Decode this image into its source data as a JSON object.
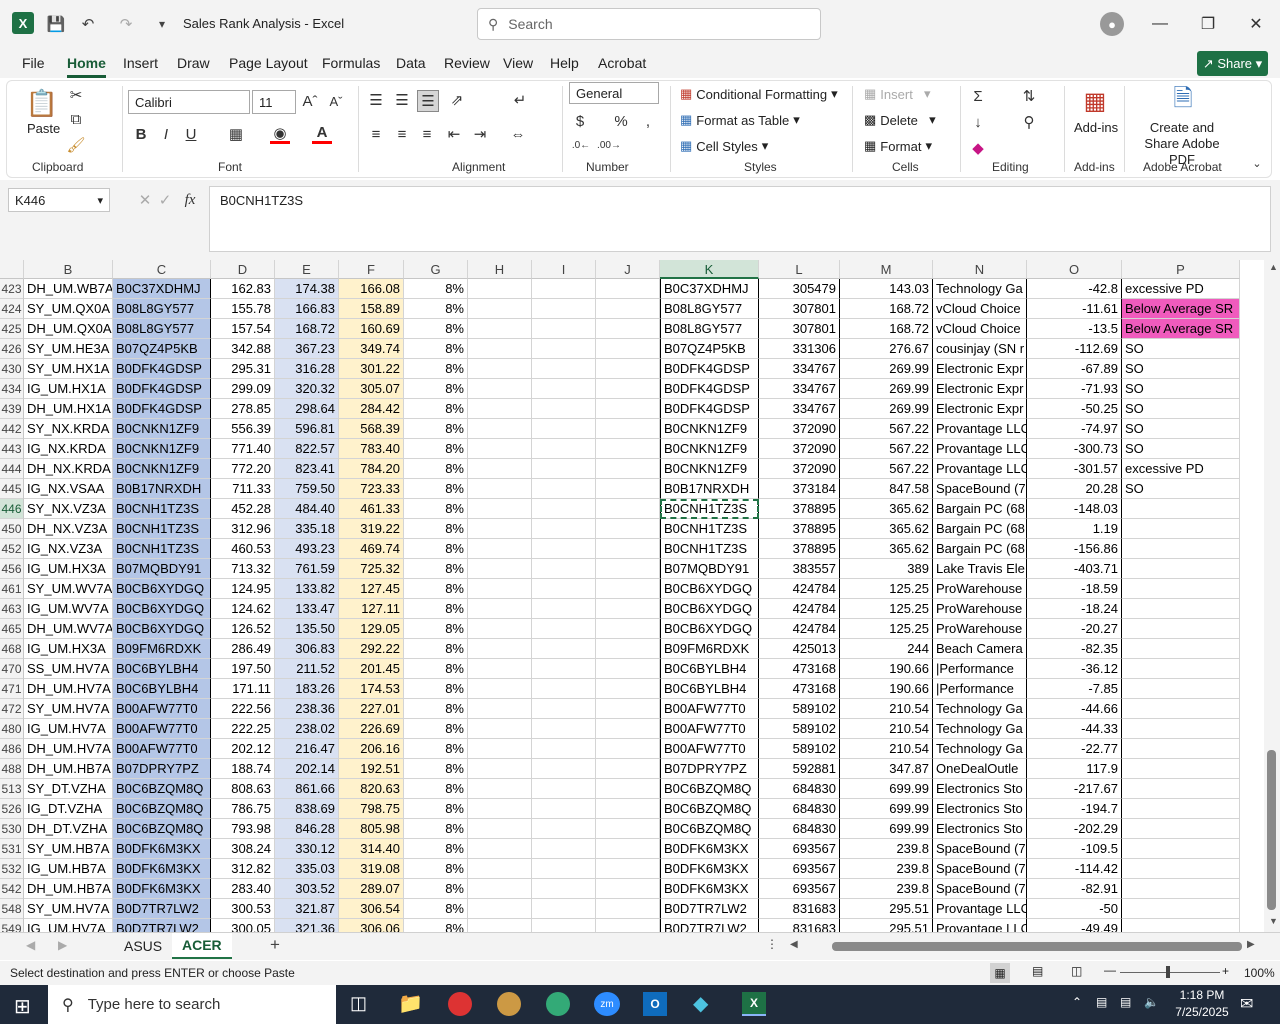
{
  "titlebar": {
    "doc_title": "Sales Rank Analysis  -  Excel",
    "search_placeholder": "Search"
  },
  "menu": [
    "File",
    "Home",
    "Insert",
    "Draw",
    "Page Layout",
    "Formulas",
    "Data",
    "Review",
    "View",
    "Help",
    "Acrobat"
  ],
  "share_label": "Share",
  "ribbon": {
    "paste": "Paste",
    "clipboard": "Clipboard",
    "font_name": "Calibri",
    "font_size": "11",
    "font": "Font",
    "alignment": "Alignment",
    "number_format": "General",
    "number": "Number",
    "cond_format": "Conditional Formatting",
    "format_table": "Format as Table",
    "cell_styles": "Cell Styles",
    "styles": "Styles",
    "insert": "Insert",
    "delete": "Delete",
    "format": "Format",
    "cells": "Cells",
    "editing": "Editing",
    "addins": "Add-ins",
    "addins_group": "Add-ins",
    "create_pdf": "Create and Share Adobe PDF",
    "acrobat_group": "Adobe Acrobat"
  },
  "formula": {
    "namebox": "K446",
    "value": "B0CNH1TZ3S"
  },
  "columns": [
    "B",
    "C",
    "D",
    "E",
    "F",
    "G",
    "H",
    "I",
    "J",
    "K",
    "L",
    "M",
    "N",
    "O",
    "P"
  ],
  "rows": [
    {
      "n": "423",
      "b": "DH_UM.WB7A",
      "c": "B0C37XDHMJ",
      "d": "162.83",
      "e": "174.38",
      "f": "166.08",
      "g": "8%",
      "k": "B0C37XDHMJ",
      "l": "305479",
      "m": "143.03",
      "nn": "Technology Ga",
      "o": "-42.8",
      "p": "excessive PD",
      "pink": false
    },
    {
      "n": "424",
      "b": "SY_UM.QX0A",
      "c": "B08L8GY577",
      "d": "155.78",
      "e": "166.83",
      "f": "158.89",
      "g": "8%",
      "k": "B08L8GY577",
      "l": "307801",
      "m": "168.72",
      "nn": "vCloud Choice",
      "o": "-11.61",
      "p": "Below Average SR",
      "pink": true
    },
    {
      "n": "425",
      "b": "DH_UM.QX0A",
      "c": "B08L8GY577",
      "d": "157.54",
      "e": "168.72",
      "f": "160.69",
      "g": "8%",
      "k": "B08L8GY577",
      "l": "307801",
      "m": "168.72",
      "nn": "vCloud Choice",
      "o": "-13.5",
      "p": "Below Average SR",
      "pink": true
    },
    {
      "n": "426",
      "b": "SY_UM.HE3A",
      "c": "B07QZ4P5KB",
      "d": "342.88",
      "e": "367.23",
      "f": "349.74",
      "g": "8%",
      "k": "B07QZ4P5KB",
      "l": "331306",
      "m": "276.67",
      "nn": "cousinjay (SN r",
      "o": "-112.69",
      "p": "SO",
      "pink": false
    },
    {
      "n": "430",
      "b": "SY_UM.HX1A",
      "c": "B0DFK4GDSP",
      "d": "295.31",
      "e": "316.28",
      "f": "301.22",
      "g": "8%",
      "k": "B0DFK4GDSP",
      "l": "334767",
      "m": "269.99",
      "nn": "Electronic Expr",
      "o": "-67.89",
      "p": "SO",
      "pink": false
    },
    {
      "n": "434",
      "b": "IG_UM.HX1A",
      "c": "B0DFK4GDSP",
      "d": "299.09",
      "e": "320.32",
      "f": "305.07",
      "g": "8%",
      "k": "B0DFK4GDSP",
      "l": "334767",
      "m": "269.99",
      "nn": "Electronic Expr",
      "o": "-71.93",
      "p": "SO",
      "pink": false
    },
    {
      "n": "439",
      "b": "DH_UM.HX1A",
      "c": "B0DFK4GDSP",
      "d": "278.85",
      "e": "298.64",
      "f": "284.42",
      "g": "8%",
      "k": "B0DFK4GDSP",
      "l": "334767",
      "m": "269.99",
      "nn": "Electronic Expr",
      "o": "-50.25",
      "p": "SO",
      "pink": false
    },
    {
      "n": "442",
      "b": "SY_NX.KRDA",
      "c": "B0CNKN1ZF9",
      "d": "556.39",
      "e": "596.81",
      "f": "568.39",
      "g": "8%",
      "k": "B0CNKN1ZF9",
      "l": "372090",
      "m": "567.22",
      "nn": "Provantage LLC",
      "o": "-74.97",
      "p": "SO",
      "pink": false
    },
    {
      "n": "443",
      "b": "IG_NX.KRDA",
      "c": "B0CNKN1ZF9",
      "d": "771.40",
      "e": "822.57",
      "f": "783.40",
      "g": "8%",
      "k": "B0CNKN1ZF9",
      "l": "372090",
      "m": "567.22",
      "nn": "Provantage LLC",
      "o": "-300.73",
      "p": "SO",
      "pink": false
    },
    {
      "n": "444",
      "b": "DH_NX.KRDA",
      "c": "B0CNKN1ZF9",
      "d": "772.20",
      "e": "823.41",
      "f": "784.20",
      "g": "8%",
      "k": "B0CNKN1ZF9",
      "l": "372090",
      "m": "567.22",
      "nn": "Provantage LLC",
      "o": "-301.57",
      "p": "excessive PD",
      "pink": false
    },
    {
      "n": "445",
      "b": "IG_NX.VSAA",
      "c": "B0B17NRXDH",
      "d": "711.33",
      "e": "759.50",
      "f": "723.33",
      "g": "8%",
      "k": "B0B17NRXDH",
      "l": "373184",
      "m": "847.58",
      "nn": "SpaceBound (7",
      "o": "20.28",
      "p": "SO",
      "pink": false
    },
    {
      "n": "446",
      "b": "SY_NX.VZ3A",
      "c": "B0CNH1TZ3S",
      "d": "452.28",
      "e": "484.40",
      "f": "461.33",
      "g": "8%",
      "k": "B0CNH1TZ3S",
      "l": "378895",
      "m": "365.62",
      "nn": "Bargain PC (68",
      "o": "-148.03",
      "p": "",
      "pink": false
    },
    {
      "n": "450",
      "b": "DH_NX.VZ3A",
      "c": "B0CNH1TZ3S",
      "d": "312.96",
      "e": "335.18",
      "f": "319.22",
      "g": "8%",
      "k": "B0CNH1TZ3S",
      "l": "378895",
      "m": "365.62",
      "nn": "Bargain PC (68",
      "o": "1.19",
      "p": "",
      "pink": false
    },
    {
      "n": "452",
      "b": "IG_NX.VZ3A",
      "c": "B0CNH1TZ3S",
      "d": "460.53",
      "e": "493.23",
      "f": "469.74",
      "g": "8%",
      "k": "B0CNH1TZ3S",
      "l": "378895",
      "m": "365.62",
      "nn": "Bargain PC (68",
      "o": "-156.86",
      "p": "",
      "pink": false
    },
    {
      "n": "456",
      "b": "IG_UM.HX3A",
      "c": "B07MQBDY91",
      "d": "713.32",
      "e": "761.59",
      "f": "725.32",
      "g": "8%",
      "k": "B07MQBDY91",
      "l": "383557",
      "m": "389",
      "nn": "Lake Travis Ele",
      "o": "-403.71",
      "p": "",
      "pink": false
    },
    {
      "n": "461",
      "b": "SY_UM.WV7A",
      "c": "B0CB6XYDGQ",
      "d": "124.95",
      "e": "133.82",
      "f": "127.45",
      "g": "8%",
      "k": "B0CB6XYDGQ",
      "l": "424784",
      "m": "125.25",
      "nn": "ProWarehouse",
      "o": "-18.59",
      "p": "",
      "pink": false
    },
    {
      "n": "463",
      "b": "IG_UM.WV7A",
      "c": "B0CB6XYDGQ",
      "d": "124.62",
      "e": "133.47",
      "f": "127.11",
      "g": "8%",
      "k": "B0CB6XYDGQ",
      "l": "424784",
      "m": "125.25",
      "nn": "ProWarehouse",
      "o": "-18.24",
      "p": "",
      "pink": false
    },
    {
      "n": "465",
      "b": "DH_UM.WV7A",
      "c": "B0CB6XYDGQ",
      "d": "126.52",
      "e": "135.50",
      "f": "129.05",
      "g": "8%",
      "k": "B0CB6XYDGQ",
      "l": "424784",
      "m": "125.25",
      "nn": "ProWarehouse",
      "o": "-20.27",
      "p": "",
      "pink": false
    },
    {
      "n": "468",
      "b": "IG_UM.HX3A",
      "c": "B09FM6RDXK",
      "d": "286.49",
      "e": "306.83",
      "f": "292.22",
      "g": "8%",
      "k": "B09FM6RDXK",
      "l": "425013",
      "m": "244",
      "nn": "Beach Camera",
      "o": "-82.35",
      "p": "",
      "pink": false
    },
    {
      "n": "470",
      "b": "SS_UM.HV7A",
      "c": "B0C6BYLBH4",
      "d": "197.50",
      "e": "211.52",
      "f": "201.45",
      "g": "8%",
      "k": "B0C6BYLBH4",
      "l": "473168",
      "m": "190.66",
      "nn": "|Performance",
      "o": "-36.12",
      "p": "",
      "pink": false
    },
    {
      "n": "471",
      "b": "DH_UM.HV7A",
      "c": "B0C6BYLBH4",
      "d": "171.11",
      "e": "183.26",
      "f": "174.53",
      "g": "8%",
      "k": "B0C6BYLBH4",
      "l": "473168",
      "m": "190.66",
      "nn": "|Performance",
      "o": "-7.85",
      "p": "",
      "pink": false
    },
    {
      "n": "472",
      "b": "SY_UM.HV7A",
      "c": "B00AFW77T0",
      "d": "222.56",
      "e": "238.36",
      "f": "227.01",
      "g": "8%",
      "k": "B00AFW77T0",
      "l": "589102",
      "m": "210.54",
      "nn": "Technology Ga",
      "o": "-44.66",
      "p": "",
      "pink": false
    },
    {
      "n": "480",
      "b": "IG_UM.HV7A",
      "c": "B00AFW77T0",
      "d": "222.25",
      "e": "238.02",
      "f": "226.69",
      "g": "8%",
      "k": "B00AFW77T0",
      "l": "589102",
      "m": "210.54",
      "nn": "Technology Ga",
      "o": "-44.33",
      "p": "",
      "pink": false
    },
    {
      "n": "486",
      "b": "DH_UM.HV7A",
      "c": "B00AFW77T0",
      "d": "202.12",
      "e": "216.47",
      "f": "206.16",
      "g": "8%",
      "k": "B00AFW77T0",
      "l": "589102",
      "m": "210.54",
      "nn": "Technology Ga",
      "o": "-22.77",
      "p": "",
      "pink": false
    },
    {
      "n": "488",
      "b": "DH_UM.HB7A",
      "c": "B07DPRY7PZ",
      "d": "188.74",
      "e": "202.14",
      "f": "192.51",
      "g": "8%",
      "k": "B07DPRY7PZ",
      "l": "592881",
      "m": "347.87",
      "nn": "OneDealOutle",
      "o": "117.9",
      "p": "",
      "pink": false
    },
    {
      "n": "513",
      "b": "SY_DT.VZHA",
      "c": "B0C6BZQM8Q",
      "d": "808.63",
      "e": "861.66",
      "f": "820.63",
      "g": "8%",
      "k": "B0C6BZQM8Q",
      "l": "684830",
      "m": "699.99",
      "nn": "Electronics Sto",
      "o": "-217.67",
      "p": "",
      "pink": false
    },
    {
      "n": "526",
      "b": "IG_DT.VZHA",
      "c": "B0C6BZQM8Q",
      "d": "786.75",
      "e": "838.69",
      "f": "798.75",
      "g": "8%",
      "k": "B0C6BZQM8Q",
      "l": "684830",
      "m": "699.99",
      "nn": "Electronics Sto",
      "o": "-194.7",
      "p": "",
      "pink": false
    },
    {
      "n": "530",
      "b": "DH_DT.VZHA",
      "c": "B0C6BZQM8Q",
      "d": "793.98",
      "e": "846.28",
      "f": "805.98",
      "g": "8%",
      "k": "B0C6BZQM8Q",
      "l": "684830",
      "m": "699.99",
      "nn": "Electronics Sto",
      "o": "-202.29",
      "p": "",
      "pink": false
    },
    {
      "n": "531",
      "b": "SY_UM.HB7A",
      "c": "B0DFK6M3KX",
      "d": "308.24",
      "e": "330.12",
      "f": "314.40",
      "g": "8%",
      "k": "B0DFK6M3KX",
      "l": "693567",
      "m": "239.8",
      "nn": "SpaceBound (7",
      "o": "-109.5",
      "p": "",
      "pink": false
    },
    {
      "n": "532",
      "b": "IG_UM.HB7A",
      "c": "B0DFK6M3KX",
      "d": "312.82",
      "e": "335.03",
      "f": "319.08",
      "g": "8%",
      "k": "B0DFK6M3KX",
      "l": "693567",
      "m": "239.8",
      "nn": "SpaceBound (7",
      "o": "-114.42",
      "p": "",
      "pink": false
    },
    {
      "n": "542",
      "b": "DH_UM.HB7A",
      "c": "B0DFK6M3KX",
      "d": "283.40",
      "e": "303.52",
      "f": "289.07",
      "g": "8%",
      "k": "B0DFK6M3KX",
      "l": "693567",
      "m": "239.8",
      "nn": "SpaceBound (7",
      "o": "-82.91",
      "p": "",
      "pink": false
    },
    {
      "n": "548",
      "b": "SY_UM.HV7A",
      "c": "B0D7TR7LW2",
      "d": "300.53",
      "e": "321.87",
      "f": "306.54",
      "g": "8%",
      "k": "B0D7TR7LW2",
      "l": "831683",
      "m": "295.51",
      "nn": "Provantage LLC",
      "o": "-50",
      "p": "",
      "pink": false
    },
    {
      "n": "549",
      "b": "IG_UM.HV7A",
      "c": "B0D7TR7LW2",
      "d": "300.05",
      "e": "321.36",
      "f": "306.06",
      "g": "8%",
      "k": "B0D7TR7LW2",
      "l": "831683",
      "m": "295.51",
      "nn": "Provantage LLC",
      "o": "-49.49",
      "p": "",
      "pink": false
    }
  ],
  "sheets": [
    "ASUS",
    "ACER"
  ],
  "active_sheet": "ACER",
  "status_text": "Select destination and press ENTER or choose Paste",
  "zoom": "100%",
  "taskbar": {
    "search_placeholder": "Type here to search",
    "time": "1:18 PM",
    "date": "7/25/2025"
  },
  "colors": {
    "excel_green": "#217346",
    "col_c": "#b4c6e7",
    "col_e": "#d9e1f2",
    "col_f": "#fff2cc",
    "pink": "#f05bbd"
  }
}
